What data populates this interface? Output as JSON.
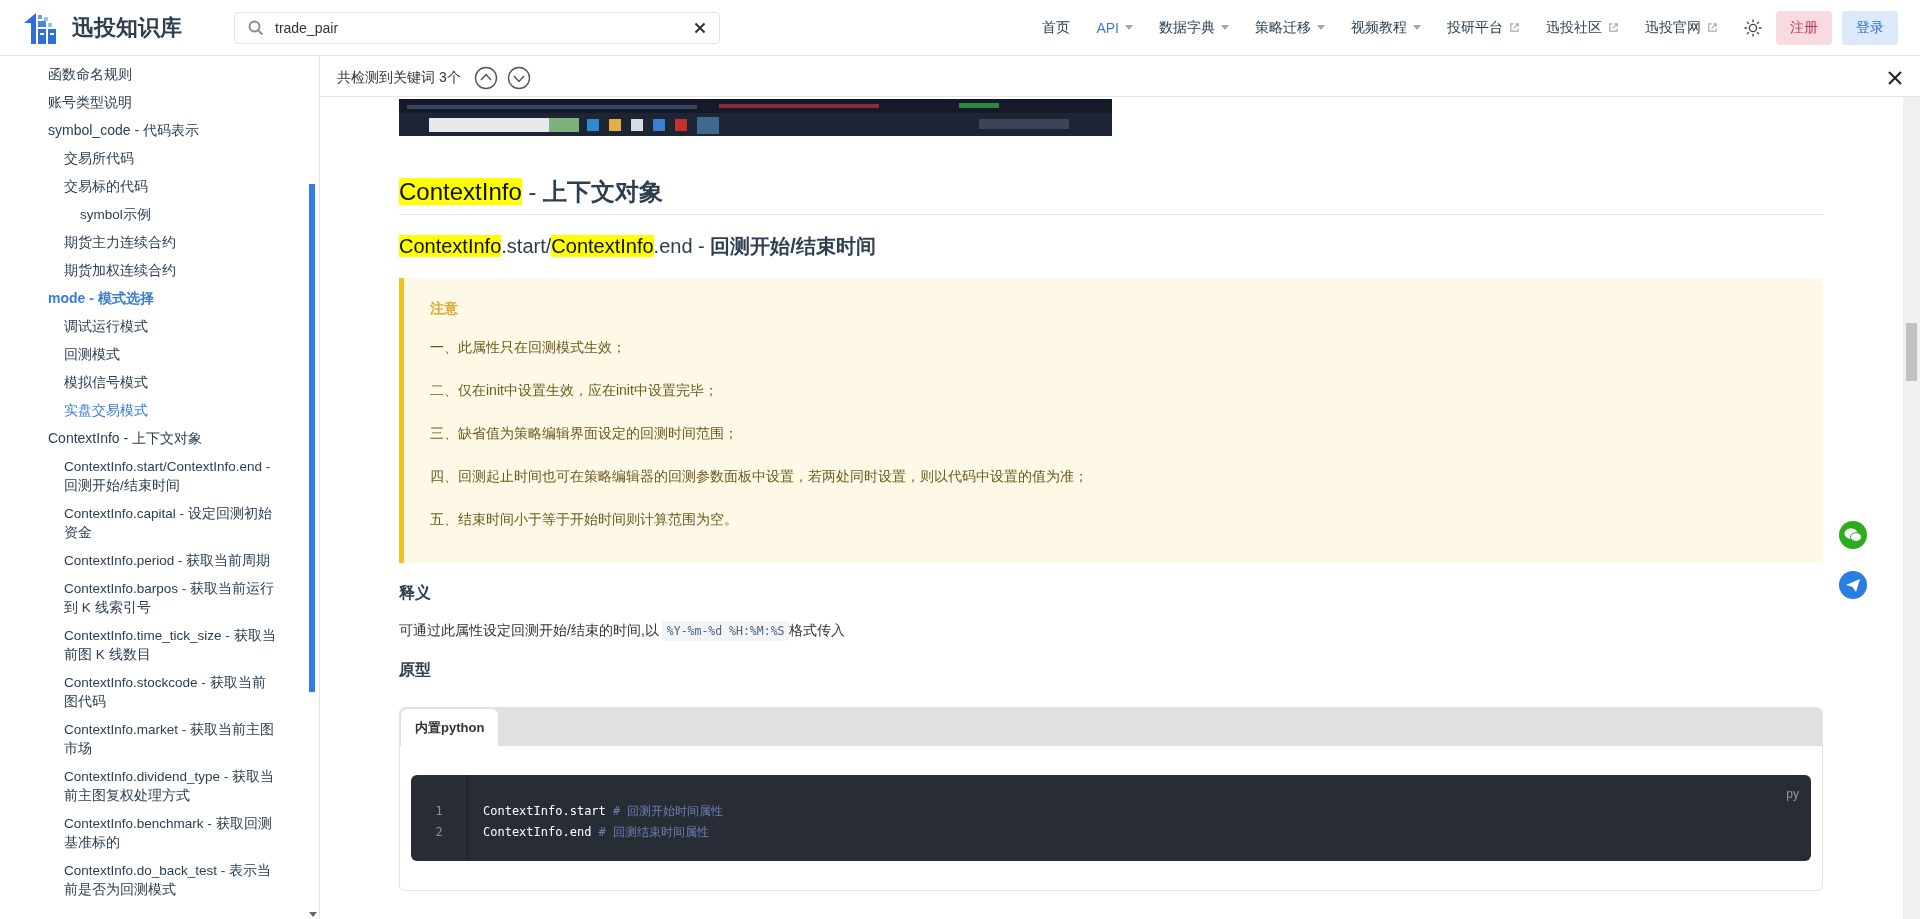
{
  "header": {
    "site_title": "迅投知识库",
    "search": {
      "value": "trade_pair"
    },
    "nav": [
      {
        "label": "首页",
        "selected": false,
        "dropdown": false,
        "external": false
      },
      {
        "label": "API",
        "selected": true,
        "dropdown": true,
        "external": false
      },
      {
        "label": "数据字典",
        "selected": false,
        "dropdown": true,
        "external": false
      },
      {
        "label": "策略迁移",
        "selected": false,
        "dropdown": true,
        "external": false
      },
      {
        "label": "视频教程",
        "selected": false,
        "dropdown": true,
        "external": false
      },
      {
        "label": "投研平台",
        "selected": false,
        "dropdown": false,
        "external": true
      },
      {
        "label": "迅投社区",
        "selected": false,
        "dropdown": false,
        "external": true
      },
      {
        "label": "迅投官网",
        "selected": false,
        "dropdown": false,
        "external": true
      }
    ],
    "register_button": "注册",
    "login_button": "登录"
  },
  "sidebar": {
    "items": [
      {
        "label": "函数命名规则",
        "selected": false
      },
      {
        "label": "账号类型说明",
        "selected": false
      },
      {
        "label": "symbol_code - 代码表示",
        "selected": false,
        "children": [
          {
            "label": "交易所代码",
            "selected": false
          },
          {
            "label": "交易标的代码",
            "selected": false,
            "children": [
              {
                "label": "symbol示例",
                "selected": false
              }
            ]
          },
          {
            "label": "期货主力连续合约",
            "selected": false
          },
          {
            "label": "期货加权连续合约",
            "selected": false
          }
        ]
      },
      {
        "label": "mode - 模式选择",
        "selected": true,
        "children": [
          {
            "label": "调试运行模式",
            "selected": false
          },
          {
            "label": "回测模式",
            "selected": false
          },
          {
            "label": "模拟信号模式",
            "selected": false
          },
          {
            "label": "实盘交易模式",
            "selected": true
          }
        ]
      },
      {
        "label": "ContextInfo - 上下文对象",
        "selected": false,
        "children": [
          {
            "label": "ContextInfo.start/ContextInfo.end - 回测开始/结束时间",
            "selected": false
          },
          {
            "label": "ContextInfo.capital - 设定回测初始资金",
            "selected": false
          },
          {
            "label": "ContextInfo.period - 获取当前周期",
            "selected": false
          },
          {
            "label": "ContextInfo.barpos - 获取当前运行到 K 线索引号",
            "selected": false
          },
          {
            "label": "ContextInfo.time_tick_size - 获取当前图 K 线数目",
            "selected": false
          },
          {
            "label": "ContextInfo.stockcode - 获取当前图代码",
            "selected": false
          },
          {
            "label": "ContextInfo.market - 获取当前主图市场",
            "selected": false
          },
          {
            "label": "ContextInfo.dividend_type - 获取当前主图复权处理方式",
            "selected": false
          },
          {
            "label": "ContextInfo.benchmark - 获取回测基准标的",
            "selected": false
          },
          {
            "label": "ContextInfo.do_back_test - 表示当前是否为回测模式",
            "selected": false
          }
        ]
      }
    ]
  },
  "find_bar": {
    "text": "共检测到关键词 3个"
  },
  "content": {
    "title": [
      {
        "text": "ContextInfo",
        "kind": "highlight"
      },
      {
        "text": " - ",
        "kind": "plain"
      },
      {
        "text": "上下文对象",
        "kind": "bold"
      }
    ],
    "subtitle": [
      {
        "text": "ContextInfo",
        "kind": "highlight"
      },
      {
        "text": ".start/",
        "kind": "plain"
      },
      {
        "text": "ContextInfo",
        "kind": "highlight"
      },
      {
        "text": ".end - ",
        "kind": "plain"
      },
      {
        "text": "回测开始/结束时间",
        "kind": "bold"
      }
    ],
    "note": {
      "title": "注意",
      "lines": [
        "一、此属性只在回测模式生效；",
        "二、仅在init中设置生效，应在init中设置完毕；",
        "三、缺省值为策略编辑界面设定的回测时间范围；",
        "四、回测起止时间也可在策略编辑器的回测参数面板中设置，若两处同时设置，则以代码中设置的值为准；",
        "五、结束时间小于等于开始时间则计算范围为空。"
      ]
    },
    "meaning_heading": "释义",
    "meaning": [
      {
        "text": "可通过此属性设定回测开始/结束的时间,以",
        "kind": "plain"
      },
      {
        "text": "%Y-%m-%d %H:%M:%S",
        "kind": "code"
      },
      {
        "text": "格式传入",
        "kind": "plain"
      }
    ],
    "prototype_heading": "原型",
    "code_tabs": [
      {
        "label": "内置python",
        "selected": true
      }
    ],
    "code": {
      "lang": "py",
      "lines": [
        {
          "number": "1",
          "code": "ContextInfo.start",
          "comment": "# 回测开始时间属性"
        },
        {
          "number": "2",
          "code": "ContextInfo.end",
          "comment": "# 回测结束时间属性"
        }
      ]
    }
  }
}
